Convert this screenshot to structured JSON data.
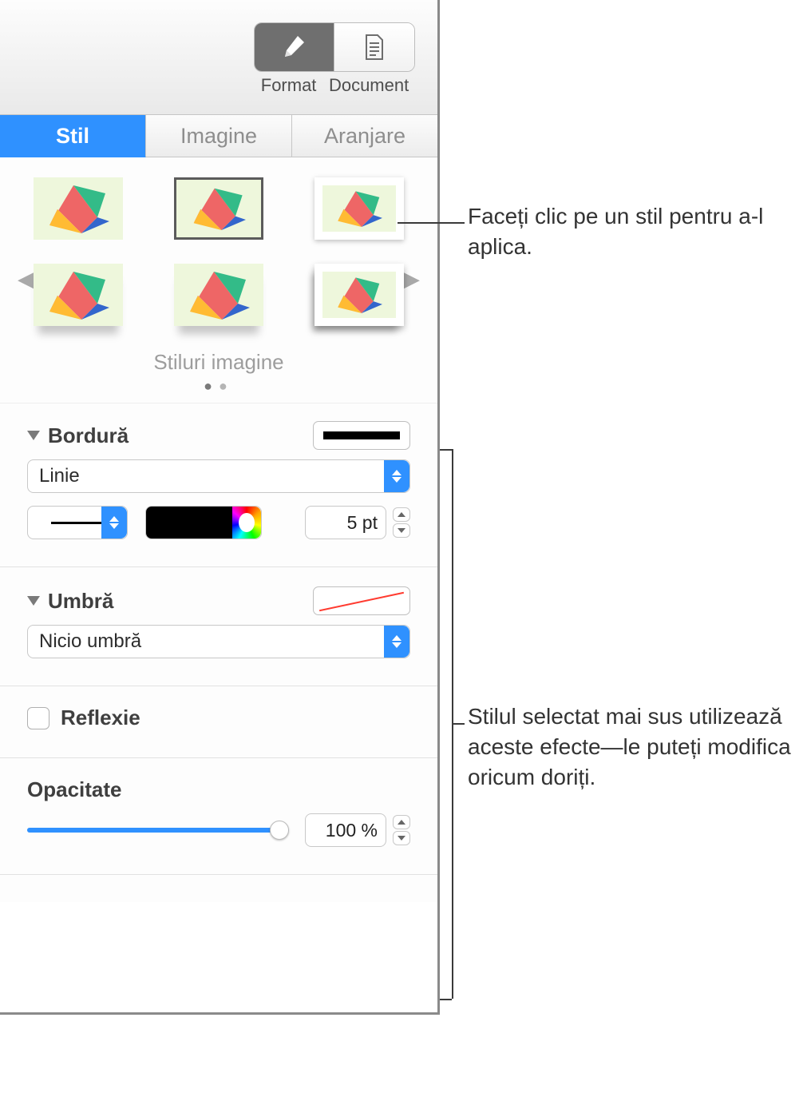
{
  "toolbar": {
    "format_label": "Format",
    "document_label": "Document"
  },
  "tabs": {
    "style": "Stil",
    "image": "Imagine",
    "arrange": "Aranjare"
  },
  "gallery": {
    "title": "Stiluri imagine"
  },
  "border": {
    "title": "Bordură",
    "line_type": "Linie",
    "width_value": "5 pt",
    "color": "#000000"
  },
  "shadow": {
    "title": "Umbră",
    "value": "Nicio umbră"
  },
  "reflection": {
    "label": "Reflexie",
    "checked": false
  },
  "opacity": {
    "label": "Opacitate",
    "value": "100 %",
    "percent": 100
  },
  "callouts": {
    "styles": "Faceți clic pe un stil pentru a-l aplica.",
    "effects": "Stilul selectat mai sus utilizează aceste efecte—le puteți modifica oricum doriți."
  }
}
